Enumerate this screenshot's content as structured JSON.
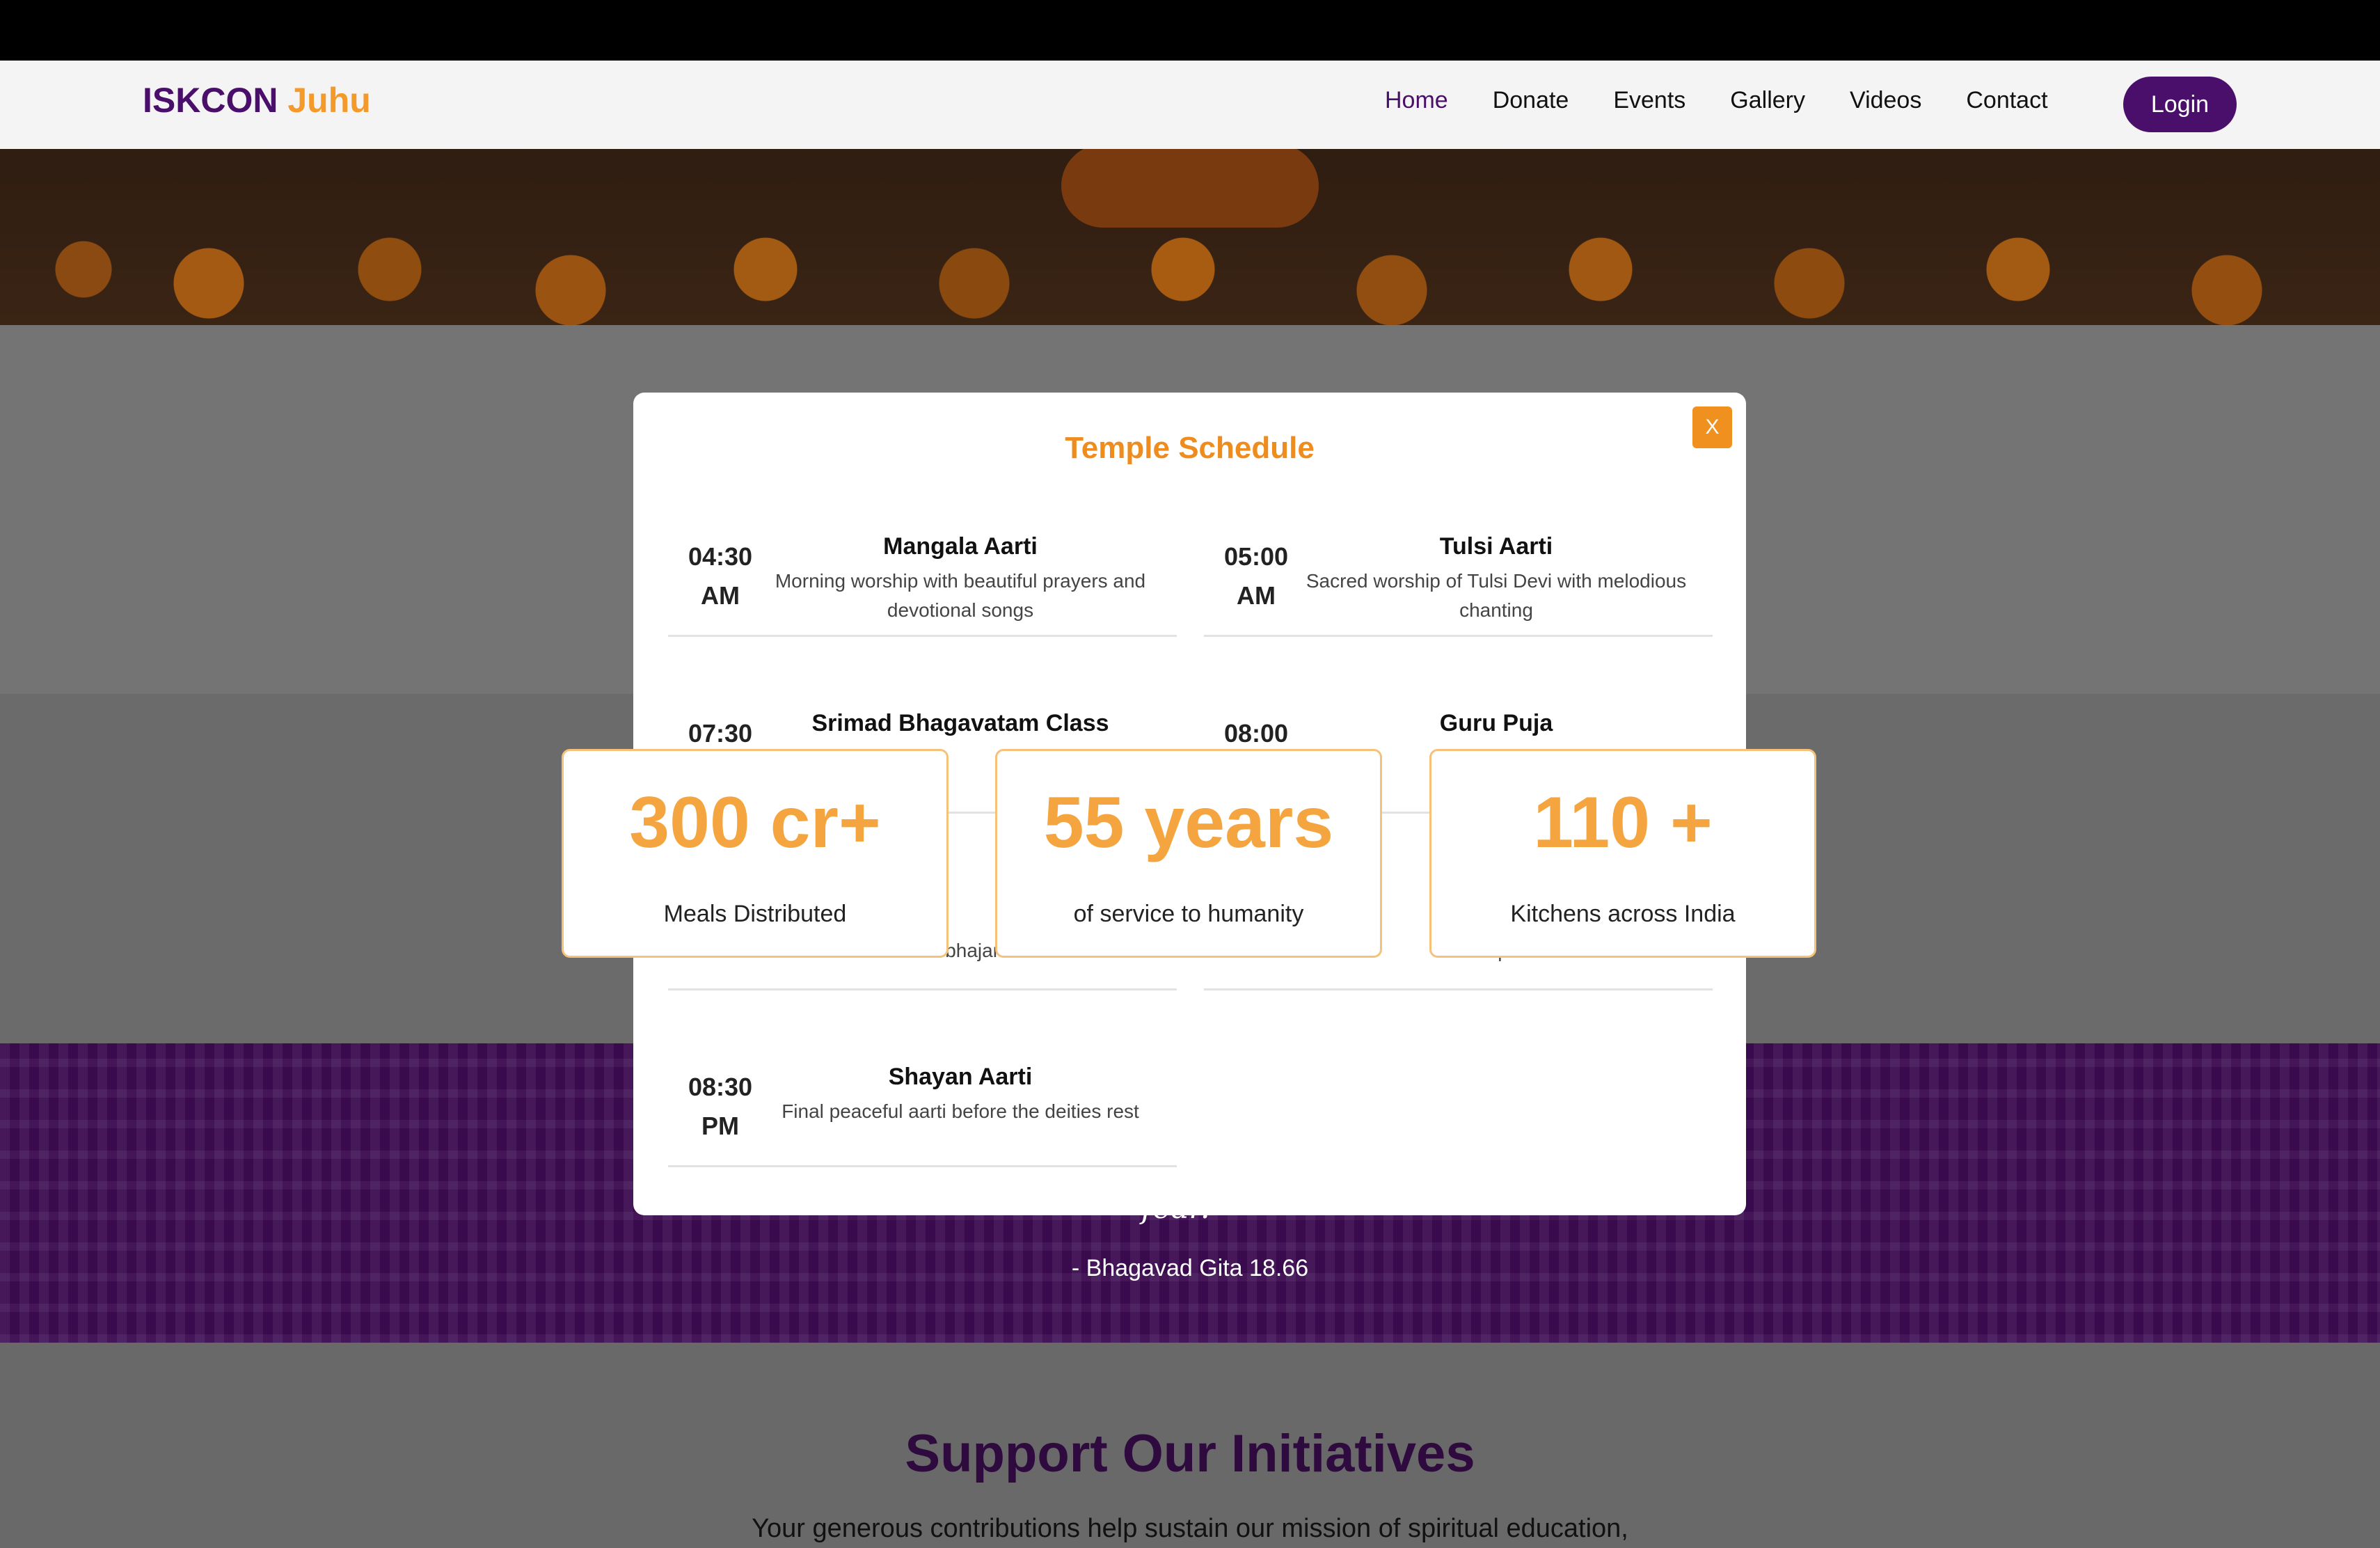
{
  "brand": {
    "name_part1": "ISKCON",
    "name_part2": "Juhu"
  },
  "nav": {
    "items": [
      "Home",
      "Donate",
      "Events",
      "Gallery",
      "Videos",
      "Contact"
    ],
    "login": "Login"
  },
  "modal": {
    "title": "Temple Schedule",
    "close": "X",
    "items": [
      {
        "time_h": "04:30",
        "time_p": "AM",
        "name": "Mangala Aarti",
        "desc": "Morning worship with beautiful prayers and devotional songs"
      },
      {
        "time_h": "05:00",
        "time_p": "AM",
        "name": "Tulsi Aarti",
        "desc": "Sacred worship of Tulsi Devi with melodious chanting"
      },
      {
        "time_h": "07:30",
        "time_p": "AM",
        "name": "Srimad Bhagavatam Class",
        "desc": ""
      },
      {
        "time_h": "08:00",
        "time_p": "AM",
        "name": "Guru Puja",
        "desc": ""
      },
      {
        "time_h": "",
        "time_p": "",
        "name": "",
        "desc": "and bhajans"
      },
      {
        "time_h": "",
        "time_p": "",
        "name": "",
        "desc": "atmosphere"
      },
      {
        "time_h": "08:30",
        "time_p": "PM",
        "name": "Shayan Aarti",
        "desc": "Final peaceful aarti before the deities rest"
      }
    ]
  },
  "stats": [
    {
      "value": "300 cr+",
      "label": "Meals Distributed"
    },
    {
      "value": "55 years",
      "label": "of service to humanity"
    },
    {
      "value": "110 +",
      "label": "Kitchens across India"
    }
  ],
  "quote": {
    "tail": "fear.",
    "source": "- Bhagavad Gita 18.66"
  },
  "support": {
    "title": "Support Our Initiatives",
    "text": "Your generous contributions help sustain our mission of spiritual education,"
  },
  "colors": {
    "brand_purple": "#4a0f6b",
    "accent_orange": "#f39a2a",
    "stat_orange": "#f5a53f"
  }
}
